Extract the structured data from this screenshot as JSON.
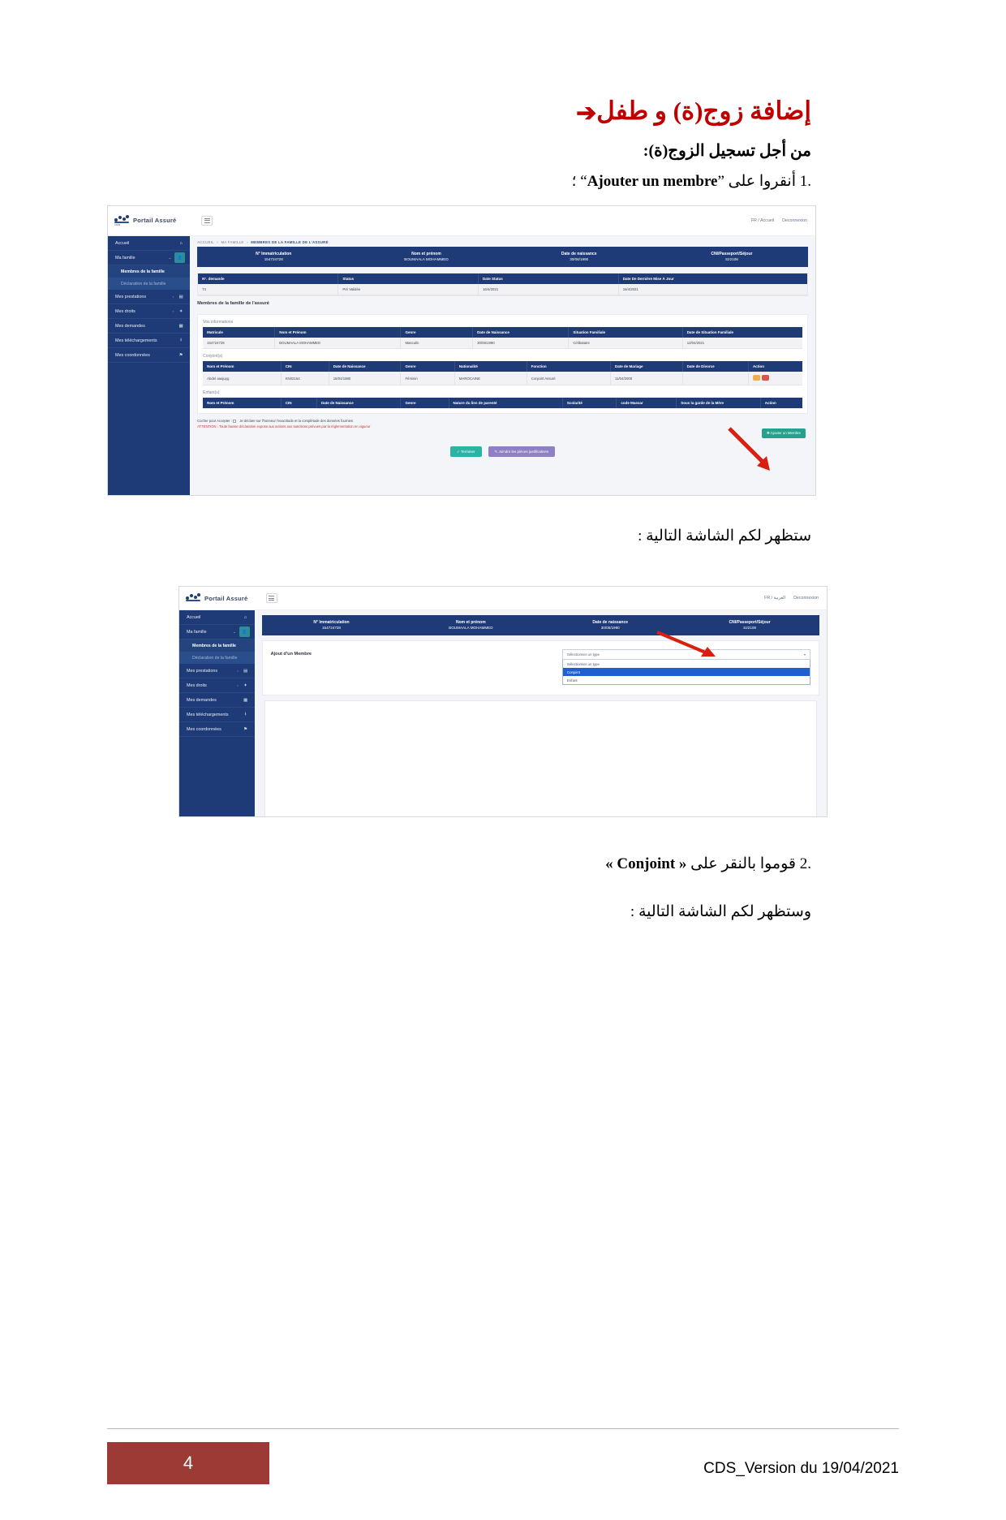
{
  "page": {
    "title_arabic": "إضافة زوج(ة) و طفل",
    "title_arrow": "➔",
    "subhead": "من أجل تسجيل الزوج(ة):",
    "step1_prefix": ".1",
    "step1_text": "أنقروا على ”",
    "step1_bold": "Ajouter un membre",
    "step1_suffix": "“ ؛",
    "caption1": "ستظهر لكم الشاشة التالية :",
    "step2_prefix": ".2",
    "step2_text": "قوموا بالنقر على",
    "step2_bold": "« Conjoint »",
    "caption2": "وستظهر لكم الشاشة التالية :",
    "page_number": "4",
    "version": "CDS_Version du 19/04/2021"
  },
  "colors": {
    "title_red": "#C00000",
    "nav_blue": "#1F3B77",
    "teal": "#25A18E",
    "purple": "#8F7FC4",
    "footer_maroon": "#9C3B36",
    "arrow_red": "#D91F11"
  },
  "shot1": {
    "brand": "Portail Assuré",
    "brand_sub": "CNSS",
    "top_right": [
      "FR / Accueil",
      "Deconnexion"
    ],
    "breadcrumb": {
      "items": [
        "ACCUEIL",
        "MA FAMILLE"
      ],
      "current": "MEMBRES DE LA FAMILLE DE L'ASSURÉ",
      "separator": "›"
    },
    "sidebar": [
      {
        "label": "Accueil",
        "icon": "home-icon",
        "badge": false,
        "caret": false
      },
      {
        "label": "Ma famille",
        "icon": "users-icon",
        "badge": true,
        "caret": true
      },
      {
        "label": "Membres de la famille",
        "sub": true,
        "active": true
      },
      {
        "label": "Déclaration de la famille",
        "sub": true,
        "active": false
      },
      {
        "label": "Mes prestations",
        "icon": "box-icon",
        "badge": false,
        "caret": true
      },
      {
        "label": "Mes droits",
        "icon": "shield-icon",
        "badge": false,
        "caret": true
      },
      {
        "label": "Mes demandes",
        "icon": "doc-icon",
        "badge": false,
        "caret": false
      },
      {
        "label": "Mes téléchargements",
        "icon": "download-icon",
        "badge": false,
        "caret": false
      },
      {
        "label": "Mes coordonnées",
        "icon": "pin-icon",
        "badge": false,
        "caret": false
      }
    ],
    "infobar": [
      {
        "title": "N° Immatriculation",
        "value": "154724728"
      },
      {
        "title": "Nom et prénom",
        "value": "BOUMAALA MOHAMMED"
      },
      {
        "title": "Date de naissance",
        "value": "30/06/1990"
      },
      {
        "title": "CNI/Passeport/Séjour",
        "value": "S22108"
      }
    ],
    "demande_table": {
      "headers": [
        "N°. demande",
        "Status",
        "Date Status",
        "Date De Dernière Mise À Jour"
      ],
      "rows": [
        [
          "74",
          "Pré Validée",
          "16/4/2021",
          "16/4/2021"
        ]
      ]
    },
    "section_title": "Membres de la famille de l'assuré",
    "vos_informations": {
      "label": "Vos informations",
      "headers": [
        "Matricule",
        "Nom et Prénom",
        "Genre",
        "Date de Naissance",
        "Situation Familiale",
        "Date de Situation Familiale"
      ],
      "rows": [
        [
          "154724728",
          "BOUMAALA MOHAMMED",
          "Masculin",
          "30/06/1990",
          "Célibataire",
          "12/04/2021"
        ]
      ]
    },
    "conjoints": {
      "label": "Conjoint(s)",
      "headers": [
        "Nom et Prénom",
        "CIN",
        "Date de Naissance",
        "Genre",
        "Nationalité",
        "Fonction",
        "Date de Mariage",
        "Date de Divorce",
        "Action"
      ],
      "rows": [
        [
          "Abdel aaajuyg",
          "KN02154",
          "18/04/1980",
          "Féminin",
          "MAROCAINE",
          "Conjoint Assuré",
          "11/04/2000",
          "",
          ""
        ]
      ]
    },
    "enfants": {
      "label": "Enfant(s)",
      "headers": [
        "Nom et Prénom",
        "CIN",
        "Date de Naissance",
        "Genre",
        "Nature du lien de parenté",
        "Scolarité",
        "code Massar",
        "Sous la garde de la Mère",
        "Action"
      ],
      "rows": []
    },
    "note": {
      "line1_prefix": "Cocher pour Accepter :",
      "line1": "Je déclare sur l'honneur l'exactitude et la complétude des données fournies",
      "line2_prefix": "ATTENTION :",
      "line2": "Toute fausse déclaration expose aux actions aux sanctions prévues par la réglementation en vigueur"
    },
    "add_member_button": "Ajouter un Membre",
    "footer_buttons": [
      {
        "label": "Terminer",
        "style": "teal",
        "icon": "check-icon"
      },
      {
        "label": "Joindre les pièces justificatives",
        "style": "purple",
        "icon": "paperclip-icon"
      }
    ]
  },
  "shot2": {
    "brand": "Portail Assuré",
    "top_right": [
      "FR / العربية",
      "Deconnexion"
    ],
    "infobar": [
      {
        "title": "N° Immatriculation",
        "value": "154724728"
      },
      {
        "title": "Nom et prénom",
        "value": "BOUMAALA MOHAMMED"
      },
      {
        "title": "Date de naissance",
        "value": "30/06/1990"
      },
      {
        "title": "CNI/Passeport/Séjour",
        "value": "S22108"
      }
    ],
    "sidebar": [
      {
        "label": "Accueil",
        "icon": "home-icon",
        "badge": false,
        "caret": false
      },
      {
        "label": "Ma famille",
        "icon": "users-icon",
        "badge": true,
        "caret": true
      },
      {
        "label": "Membres de la famille",
        "sub": true,
        "active": true
      },
      {
        "label": "Déclaration de la famille",
        "sub": true,
        "active": false
      },
      {
        "label": "Mes prestations",
        "icon": "box-icon",
        "badge": false,
        "caret": true
      },
      {
        "label": "Mes droits",
        "icon": "shield-icon",
        "badge": false,
        "caret": true
      },
      {
        "label": "Mes demandes",
        "icon": "doc-icon",
        "badge": false,
        "caret": false
      },
      {
        "label": "Mes téléchargements",
        "icon": "download-icon",
        "badge": false,
        "caret": false
      },
      {
        "label": "Mes coordonnées",
        "icon": "pin-icon",
        "badge": false,
        "caret": false
      }
    ],
    "form_label": "Ajout d'un Membre",
    "select": {
      "value": "Sélectionner un type",
      "options": [
        "Sélectionner un type",
        "Conjoint",
        "Enfant"
      ],
      "highlighted": "Conjoint"
    }
  }
}
